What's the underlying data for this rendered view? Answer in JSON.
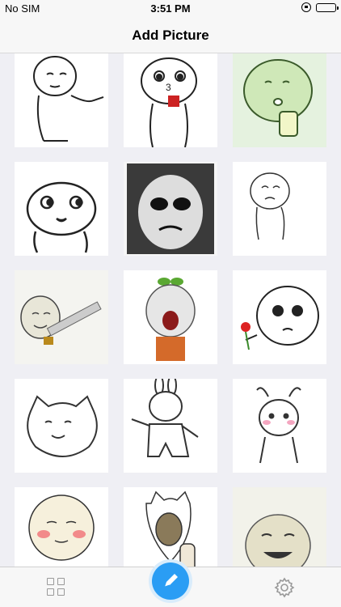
{
  "status_bar": {
    "carrier": "No SIM",
    "time": "3:51 PM"
  },
  "nav": {
    "title": "Add Picture"
  },
  "grid": {
    "items": [
      "sticker-pointing-man",
      "sticker-drinking-face",
      "sticker-green-drinking",
      "sticker-side-eye-face",
      "sticker-dark-panda-face",
      "sticker-crying-doodle",
      "sticker-sword-face",
      "sticker-turnip-screaming",
      "sticker-rose-giver",
      "sticker-cat-face",
      "sticker-bunny-pose",
      "sticker-ant-blush",
      "sticker-blushing-face",
      "sticker-cat-hand",
      "sticker-laughing-face"
    ]
  },
  "tab_bar": {
    "items": [
      "grid-icon",
      "edit-icon",
      "settings-icon"
    ],
    "accent_color": "#2a9df4"
  }
}
